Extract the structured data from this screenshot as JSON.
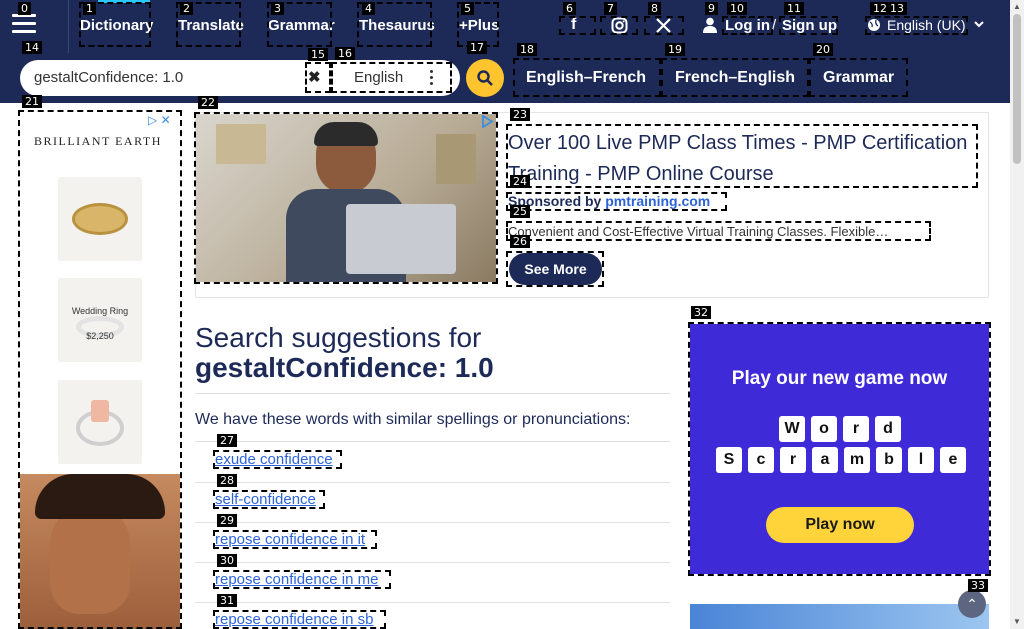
{
  "header": {
    "nav": [
      "Dictionary",
      "Translate",
      "Grammar",
      "Thesaurus",
      "+Plus"
    ],
    "login": "Log in",
    "slash": "/",
    "signup": "Sign up",
    "language": "English (UK)"
  },
  "search": {
    "value": "gestaltConfidence: 1.0",
    "dictionary": "English"
  },
  "tabs": [
    "English–French",
    "French–English",
    "Grammar"
  ],
  "left_ad": {
    "brand": "BRILLIANT EARTH",
    "ring_label": "Wedding Ring",
    "ring_price": "$2,250"
  },
  "top_ad": {
    "title": "Over 100 Live PMP Class Times - PMP Certification Training - PMP Online Course",
    "sponsored_prefix": "Sponsored by",
    "sponsor": "pmtraining.com",
    "description": "Convenient and Cost-Effective Virtual Training Classes. Flexible…",
    "cta": "See More"
  },
  "results": {
    "heading_prefix": "Search suggestions for",
    "heading_query": "gestaltConfidence: 1.0",
    "intro": "We have these words with similar spellings or pronunciations:",
    "suggestions": [
      "exude confidence",
      "self-confidence",
      "repose confidence in it",
      "repose confidence in me",
      "repose confidence in sb"
    ]
  },
  "game_ad": {
    "title": "Play our new game now",
    "word1": [
      "W",
      "o",
      "r",
      "d"
    ],
    "word2": [
      "S",
      "c",
      "r",
      "a",
      "m",
      "b",
      "l",
      "e"
    ],
    "cta": "Play now"
  },
  "labels": [
    "0",
    "1",
    "2",
    "3",
    "4",
    "5",
    "6",
    "7",
    "8",
    "9",
    "10",
    "11",
    "12",
    "13",
    "14",
    "15",
    "16",
    "17",
    "18",
    "19",
    "20",
    "21",
    "22",
    "23",
    "24",
    "25",
    "26",
    "27",
    "28",
    "29",
    "30",
    "31",
    "32",
    "33"
  ],
  "colors": {
    "navy": "#1d2a57",
    "accent_yellow": "#ffc42e",
    "link_blue": "#2c64d8",
    "game_purple": "#3f2ad8"
  }
}
